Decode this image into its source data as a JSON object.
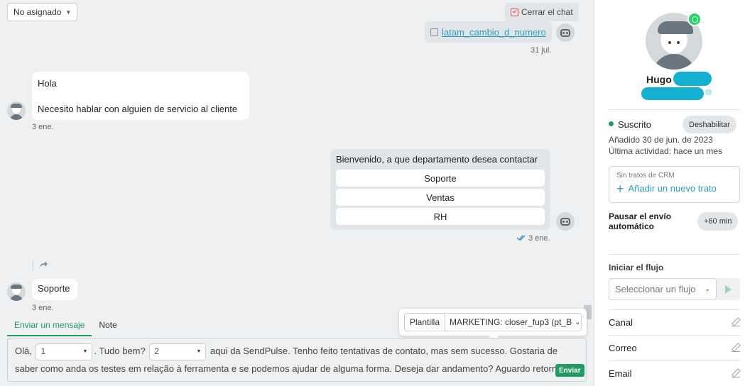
{
  "chat": {
    "assign_select": "No asignado",
    "close_chat": "Cerrar el chat",
    "flow_link": "latam_cambio_d_numero",
    "ts_flow": "31 jul.",
    "msg_user_1_line1": "Hola",
    "msg_user_1_line2": "Necesito hablar con alguien de servicio al cliente",
    "ts_user_1": "3 ene.",
    "menu_title": "Bienvenido, a que departamento desea contactar",
    "menu_buttons": [
      "Soporte",
      "Ventas",
      "RH"
    ],
    "ts_menu": "3 ene.",
    "msg_user_2": "Soporte",
    "ts_user_2": "3 ene."
  },
  "composer": {
    "tabs": [
      "Enviar un mensaje",
      "Note"
    ],
    "template_label": "Plantilla",
    "template_value": "MARKETING: closer_fup3 (pt_B",
    "text_1": "Olá,",
    "var_1": "1",
    "text_2": ". Tudo bem?",
    "var_2": "2",
    "text_3": "aqui da SendPulse. Tenho feito tentativas de contato, mas sem sucesso. Gostaria de saber como anda os testes em relação à ferramenta e se podemos ajudar de alguma forma. Deseja dar andamento? Aguardo retorno",
    "send_label": "Enviar"
  },
  "contact": {
    "name": "Hugo",
    "status": "Suscrito",
    "disable_button": "Deshabilitar",
    "added": "Añadido 30 de jun. de 2023",
    "last_activity": "Última actividad: hace un mes",
    "crm_empty": "Sin tratos de CRM",
    "crm_add": "Añadir un nuevo trato",
    "pause_label": "Pausar el envío automático",
    "pause_button": "+60 min",
    "flow_label": "Iniciar el flujo",
    "flow_placeholder": "Seleccionar un flujo",
    "fields": [
      "Canal",
      "Correo",
      "Email"
    ]
  },
  "colors": {
    "accent_green": "#1f9d63",
    "link_blue": "#2e9bc0",
    "redaction": "#13b0d0",
    "whatsapp": "#25d366"
  },
  "icons": [
    "caret-down-icon",
    "close-chat-icon",
    "calendar-icon",
    "bot-icon",
    "user-avatar-icon",
    "double-check-icon",
    "forward-icon",
    "whatsapp-icon",
    "plus-icon",
    "play-icon",
    "edit-icon"
  ]
}
